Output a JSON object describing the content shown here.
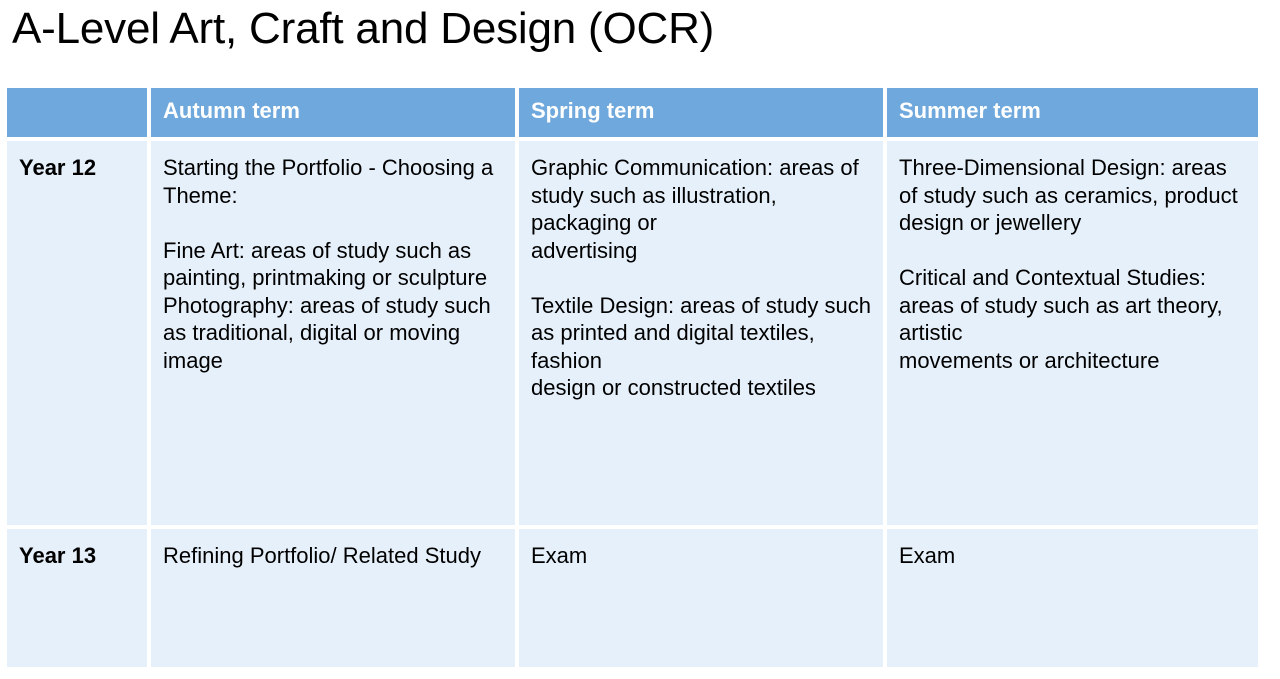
{
  "page": {
    "title": "A-Level Art, Craft and Design (OCR)"
  },
  "table": {
    "headers": [
      "",
      "Autumn term",
      "Spring term",
      "Summer term"
    ],
    "rows": [
      {
        "year": "Year 12",
        "autumn": {
          "p1": "Starting the Portfolio - Choosing a Theme:",
          "p2": "Fine Art: areas of study such as painting, printmaking or sculpture",
          "p3": "Photography: areas of study such as traditional, digital or moving image"
        },
        "spring": {
          "p1a": "Graphic Communication: areas of study such as illustration, packaging or",
          "p1b": "advertising",
          "p2a": "Textile Design: areas of study such as printed and digital textiles, fashion",
          "p2b": "design or constructed textiles"
        },
        "summer": {
          "p1a": "Three-Dimensional Design: areas of study such as ceramics, product",
          "p1b": "design or jewellery",
          "p2a": "Critical and Contextual Studies: areas of study such as art theory, artistic",
          "p2b": "movements or architecture"
        }
      },
      {
        "year": "Year 13",
        "autumn": "Refining Portfolio/ Related Study",
        "spring": "Exam",
        "summer": "Exam"
      }
    ]
  }
}
